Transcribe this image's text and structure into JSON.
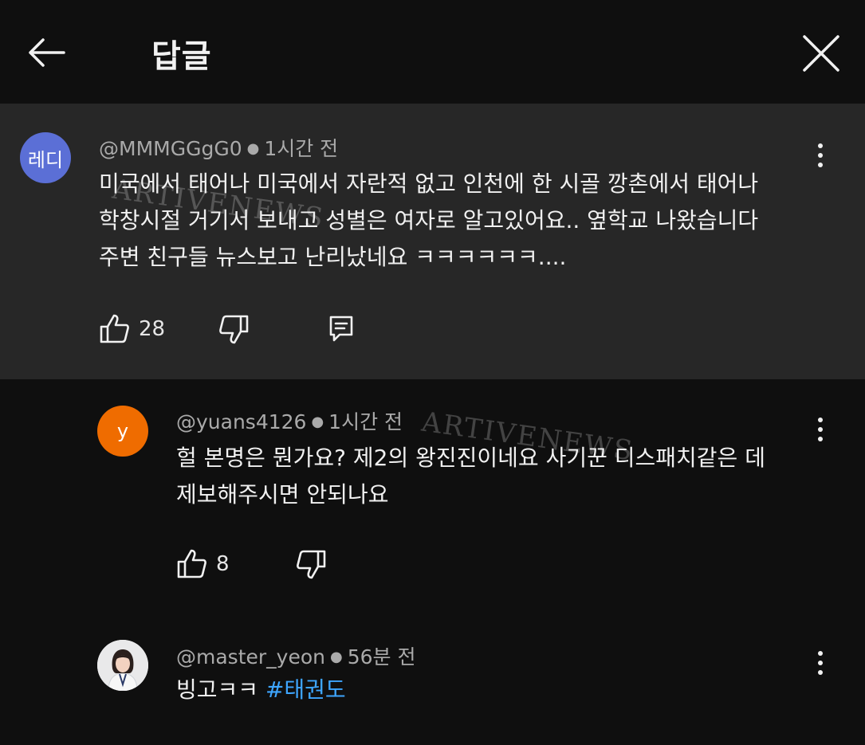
{
  "header": {
    "title": "답글"
  },
  "watermark": "ARTIVENEWS",
  "comments": [
    {
      "avatar_text": "레디",
      "avatar_color": "#5b6fd6",
      "author": "@MMMGGgG0",
      "time": "1시간 전",
      "lines": [
        "미국에서 태어나 미국에서 자란적 없고 인천에 한 시골 깡촌에서 태어나",
        "학창시절 거기서 보내고 성별은 여자로 알고있어요.. 옆학교 나왔습니다",
        "주변 친구들 뉴스보고 난리났네요 ㅋㅋㅋㅋㅋㅋ...."
      ],
      "likes": "28"
    },
    {
      "avatar_text": "y",
      "avatar_color": "#ef6c00",
      "author": "@yuans4126",
      "time": "1시간 전",
      "lines": [
        "헐 본명은 뭔가요? 제2의 왕진진이네요 사기꾼 디스패치같은 데",
        "제보해주시면 안되나요"
      ],
      "likes": "8"
    },
    {
      "author": "@master_yeon",
      "time": "56분 전",
      "text": "빙고ㅋㅋ",
      "hashtag": "#태권도"
    }
  ]
}
